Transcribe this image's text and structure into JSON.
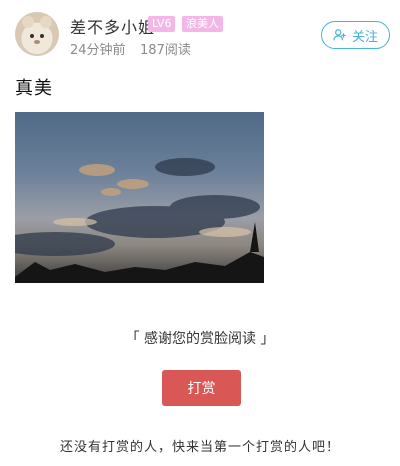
{
  "author": {
    "name": "差不多小姐",
    "level_badge": "LV6",
    "title_badge": "浪美人",
    "time": "24分钟前",
    "reads": "187阅读"
  },
  "follow_button": {
    "label": "关注"
  },
  "post": {
    "title": "真美"
  },
  "reward": {
    "thanks_text": "「 感谢您的赏脸阅读 」",
    "button_label": "打赏",
    "empty_text": "还没有打赏的人，快来当第一个打赏的人吧！"
  },
  "colors": {
    "accent_blue": "#48b2d8",
    "reward_red": "#d95754",
    "badge_pink": "#f2b7e6"
  }
}
